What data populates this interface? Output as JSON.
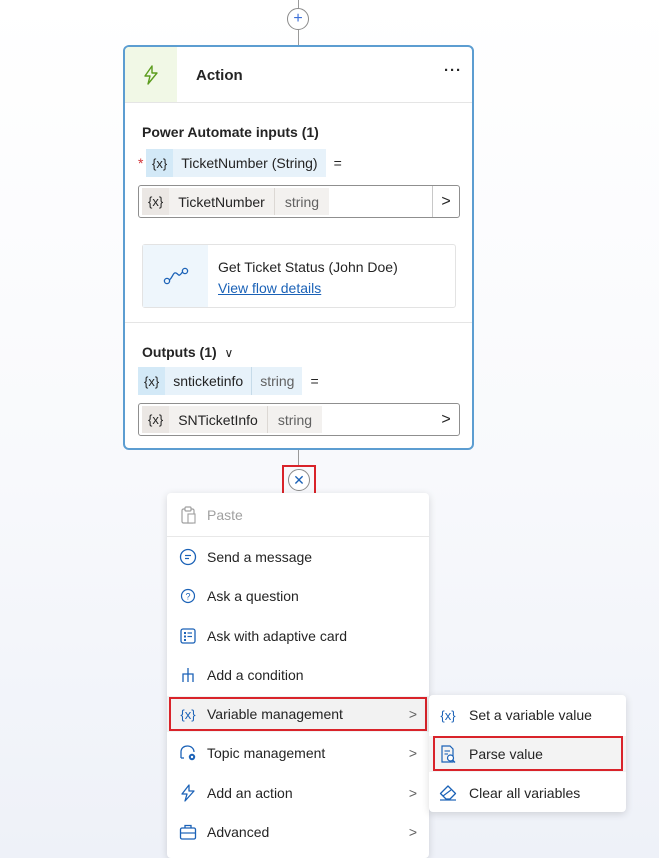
{
  "top_add": {
    "symbol": "+"
  },
  "action_card": {
    "title": "Action",
    "more": "···",
    "inputs_title": "Power Automate inputs (1)",
    "required_mark": "*",
    "input_param": {
      "token": "{x}",
      "name": "TicketNumber (String)",
      "eq": "="
    },
    "input_field": {
      "token": "{x}",
      "name": "TicketNumber",
      "type": "string",
      "chevron": ">"
    },
    "flow": {
      "name": "Get Ticket Status (John Doe)",
      "link": "View flow details"
    },
    "outputs_title": "Outputs (1)",
    "outputs_chevron": "∨",
    "output_param": {
      "token": "{x}",
      "name": "snticketinfo",
      "type": "string",
      "eq": "="
    },
    "output_field": {
      "token": "{x}",
      "name": "SNTicketInfo",
      "type": "string",
      "chevron": ">"
    }
  },
  "close_button": {
    "symbol": "✕"
  },
  "menu": {
    "items": [
      {
        "label": "Paste",
        "icon": "clipboard-icon",
        "disabled": true
      },
      {
        "label": "Send a message",
        "icon": "chat-icon"
      },
      {
        "label": "Ask a question",
        "icon": "question-icon"
      },
      {
        "label": "Ask with adaptive card",
        "icon": "adaptive-card-icon"
      },
      {
        "label": "Add a condition",
        "icon": "branch-icon"
      },
      {
        "label": "Variable management",
        "icon": "variable-icon",
        "chevron": ">",
        "selected": true
      },
      {
        "label": "Topic management",
        "icon": "topic-icon",
        "chevron": ">"
      },
      {
        "label": "Add an action",
        "icon": "lightning-icon",
        "chevron": ">"
      },
      {
        "label": "Advanced",
        "icon": "toolbox-icon",
        "chevron": ">"
      }
    ]
  },
  "submenu": {
    "items": [
      {
        "label": "Set a variable value",
        "icon": "variable-icon",
        "token": "{x}"
      },
      {
        "label": "Parse value",
        "icon": "parse-icon",
        "selected": true
      },
      {
        "label": "Clear all variables",
        "icon": "eraser-icon"
      }
    ]
  },
  "colors": {
    "card_border": "#5c9dd1",
    "highlight_red": "#d9232a",
    "link_blue": "#1b62b7",
    "var_chip_bg": "#d3e9f7",
    "action_icon_bg": "#f1f8e6"
  }
}
